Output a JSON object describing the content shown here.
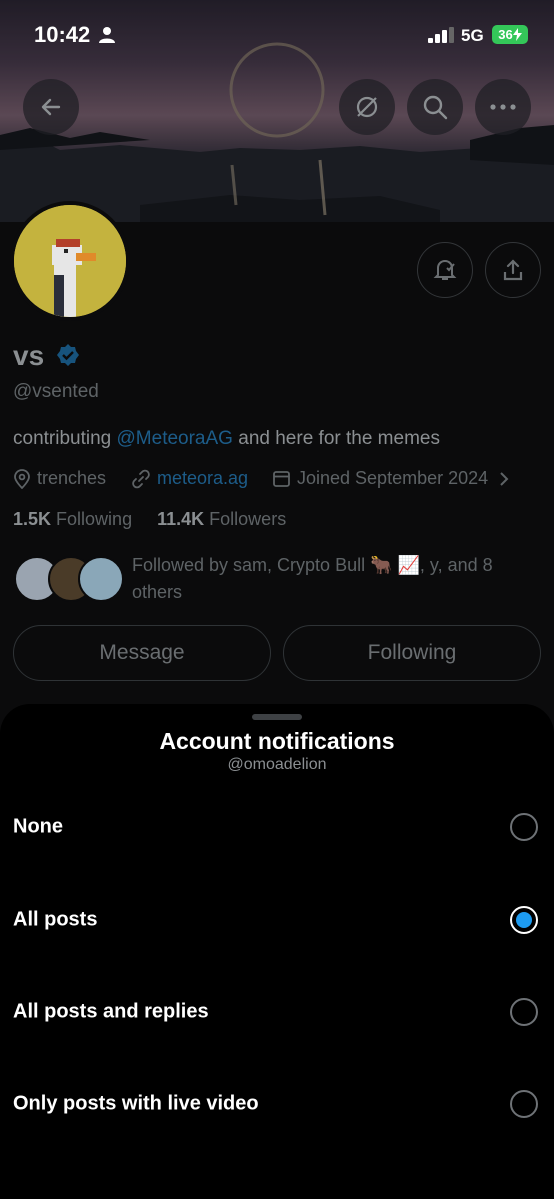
{
  "status_bar": {
    "time": "10:42",
    "network": "5G",
    "battery": "36"
  },
  "profile": {
    "name": "vs",
    "handle": "@vsented",
    "bio_prefix": "contributing ",
    "bio_mention": "@MeteoraAG",
    "bio_suffix": " and here for the memes",
    "location": "trenches",
    "website": "meteora.ag",
    "joined": "Joined September 2024",
    "following_count": "1.5K",
    "following_label": "Following",
    "followers_count": "11.4K",
    "followers_label": "Followers",
    "followed_by": "Followed by sam, Crypto Bull 🐂 📈, y, and 8 others",
    "message_button": "Message",
    "following_button": "Following",
    "verified_color": "#1d9bf0"
  },
  "sheet": {
    "title": "Account notifications",
    "subtitle": "@omoadelion",
    "options": [
      {
        "label": "None",
        "selected": false
      },
      {
        "label": "All posts",
        "selected": true
      },
      {
        "label": "All posts and replies",
        "selected": false
      },
      {
        "label": "Only posts with live video",
        "selected": false
      }
    ]
  }
}
